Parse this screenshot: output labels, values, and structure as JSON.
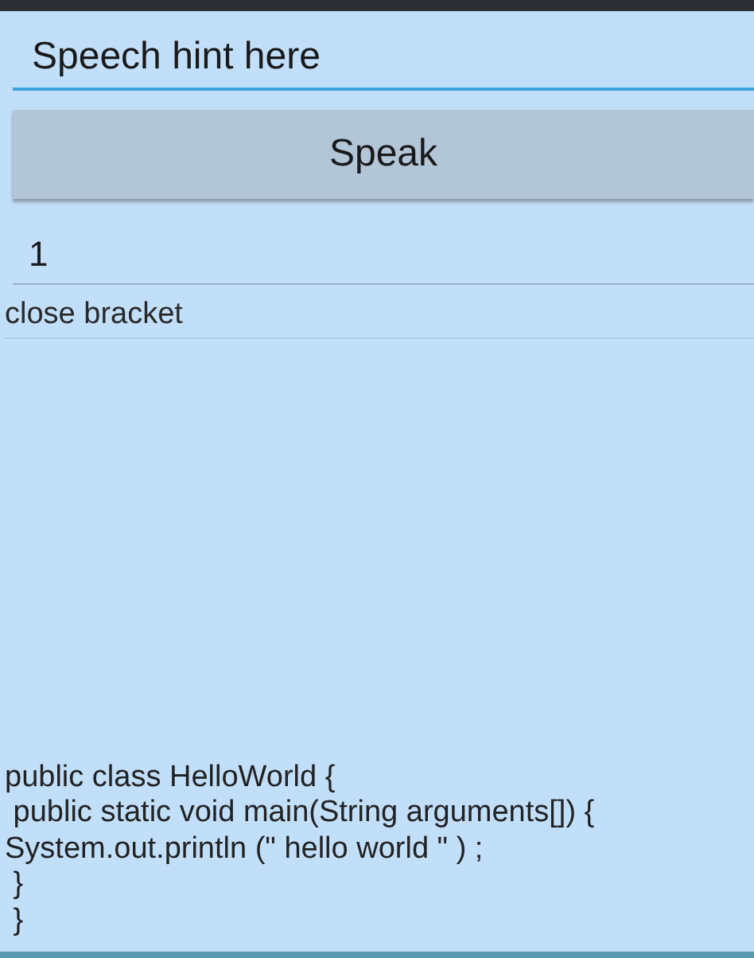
{
  "speech_field": {
    "placeholder": "Speech hint here"
  },
  "speak_button": {
    "label": "Speak"
  },
  "number_field": {
    "value": "1"
  },
  "recognized_text": "close bracket",
  "code_lines": [
    "public class HelloWorld {",
    " public static void main(String arguments[]) {",
    "System.out.println (\" hello world \" ) ;",
    " }",
    " }"
  ]
}
